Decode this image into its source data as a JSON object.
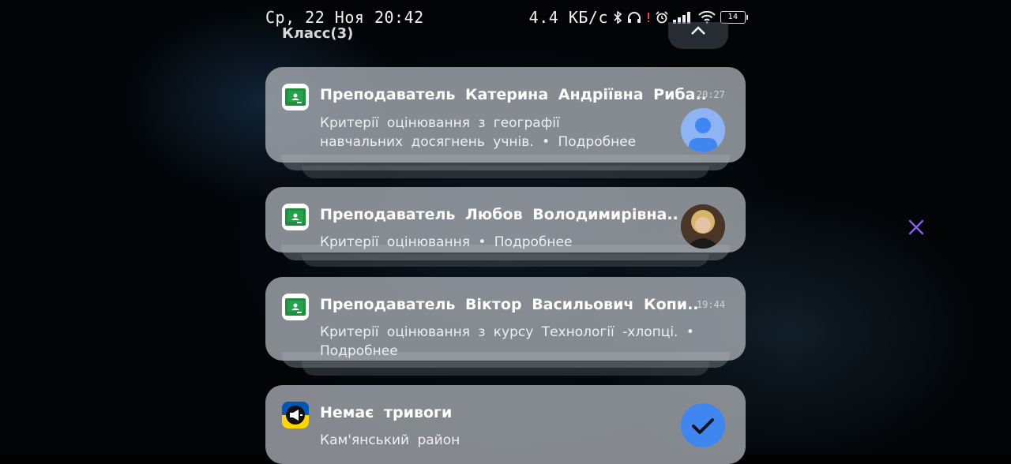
{
  "status_bar": {
    "datetime": "Ср, 22 Ноя 20:42",
    "speed": "4.4 КБ/с",
    "battery": "14"
  },
  "group": {
    "title": "Класс(3)"
  },
  "notifications": [
    {
      "app_icon": "google-classroom-icon",
      "title": "Преподаватель Катерина Андріївна Риба..",
      "time": "20:27",
      "body_line1": "Критерії оцінювання з географії",
      "body_line2": "навчальних досягнень учнів. • Подробнее",
      "avatar": "default-person-avatar"
    },
    {
      "app_icon": "google-classroom-icon",
      "title": "Преподаватель Любов Володимирівна..",
      "time": "",
      "body_line1": "Критерії оцінювання • Подробнее",
      "avatar": "photo-avatar"
    },
    {
      "app_icon": "google-classroom-icon",
      "title": "Преподаватель Віктор Васильович Копи..",
      "time": "19:44",
      "body_line1": "Критерії оцінювання з курсу Технології -хлопці. •",
      "body_line2": "Подробнее"
    },
    {
      "app_icon": "air-alert-megaphone-icon",
      "title": "Немає тривоги",
      "body_line1": "Кам'янський район",
      "status_icon": "checkmark-icon"
    }
  ],
  "colors": {
    "accent_blue": "#3f86f0",
    "card_bg": "#aab0b6",
    "classroom_green": "#1e8e3e",
    "dismiss_purple": "#8a5cf0"
  }
}
